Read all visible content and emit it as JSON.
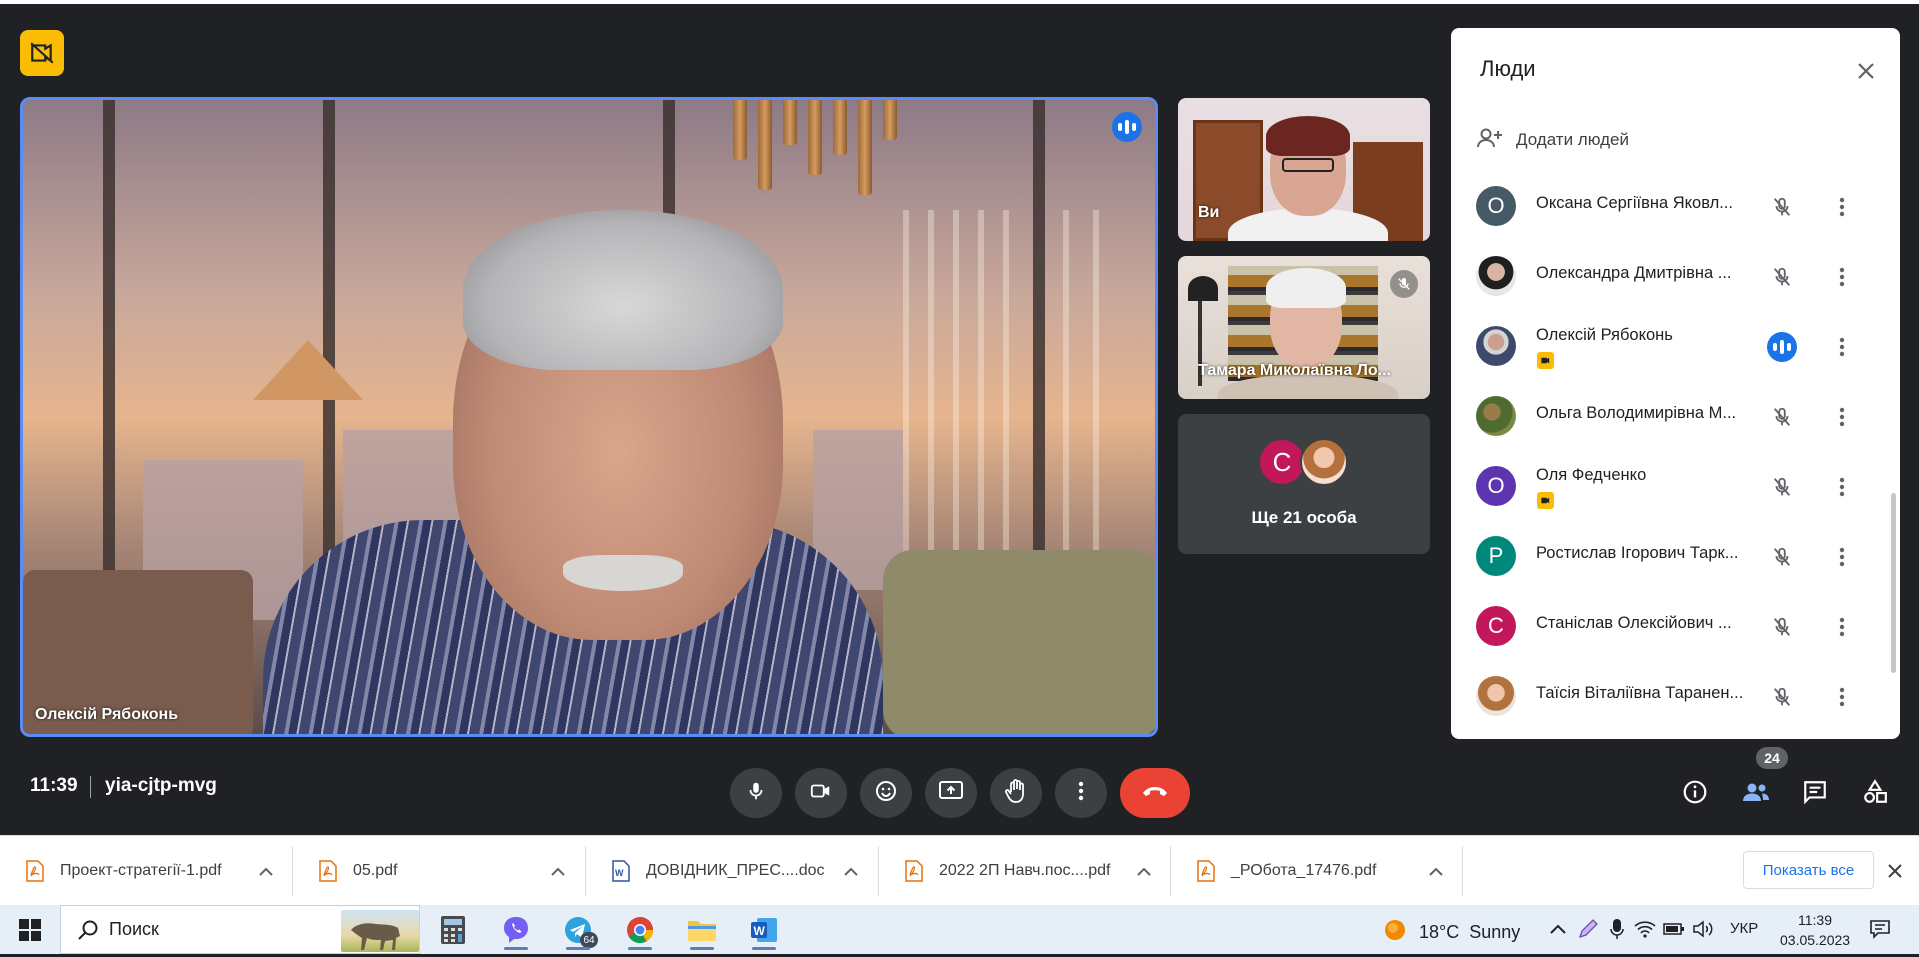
{
  "meeting": {
    "time": "11:39",
    "code": "yia-cjtp-mvg",
    "main_speaker_name": "Олексій Рябоконь",
    "self_label": "Ви",
    "tile2_name": "Тамара Миколаївна Ло...",
    "more_label": "Ще 21 особа",
    "more_avatar_letter": "C",
    "participants_count": "24",
    "accent": "#1a73e8",
    "leave_color": "#ea4335",
    "warning_color": "#fbbc04"
  },
  "people_panel": {
    "title": "Люди",
    "add_label": "Додати людей",
    "people": [
      {
        "name": "Оксана Сергіївна Яковл...",
        "avatar": "O",
        "avatar_color": "#455a64",
        "status": "muted"
      },
      {
        "name": "Олександра Дмитрівна ...",
        "avatar": "",
        "avatar_color": "#2b2b2b",
        "status": "muted"
      },
      {
        "name": "Олексій Рябоконь",
        "avatar": "",
        "avatar_color": "#6a6e7a",
        "status": "speaking",
        "badge": true
      },
      {
        "name": "Ольга Володимирівна М...",
        "avatar": "",
        "avatar_color": "#5d6b3a",
        "status": "muted"
      },
      {
        "name": "Оля Федченко",
        "avatar": "O",
        "avatar_color": "#5e35b1",
        "status": "muted",
        "badge": true
      },
      {
        "name": "Ростислав Ігорович Тарк...",
        "avatar": "P",
        "avatar_color": "#00897b",
        "status": "muted"
      },
      {
        "name": "Станіслав Олексійович ...",
        "avatar": "C",
        "avatar_color": "#c2185b",
        "status": "muted"
      },
      {
        "name": "Таїсія Віталіївна Таранен...",
        "avatar": "",
        "avatar_color": "#d7a58a",
        "status": "muted"
      }
    ]
  },
  "downloads": {
    "items": [
      {
        "name": "Проект-стратегії-1.pdf",
        "type": "pdf"
      },
      {
        "name": "05.pdf",
        "type": "pdf"
      },
      {
        "name": "ДОВІДНИК_ПРЕС....doc",
        "type": "doc"
      },
      {
        "name": "2022 2П Навч.пос....pdf",
        "type": "pdf"
      },
      {
        "name": "_РОбота_17476.pdf",
        "type": "pdf"
      }
    ],
    "show_all": "Показать все"
  },
  "taskbar": {
    "search_placeholder": "Поиск",
    "telegram_badge": "64",
    "weather": "18°C  Sunny",
    "lang": "УКР",
    "time": "11:39",
    "date": "03.05.2023"
  }
}
